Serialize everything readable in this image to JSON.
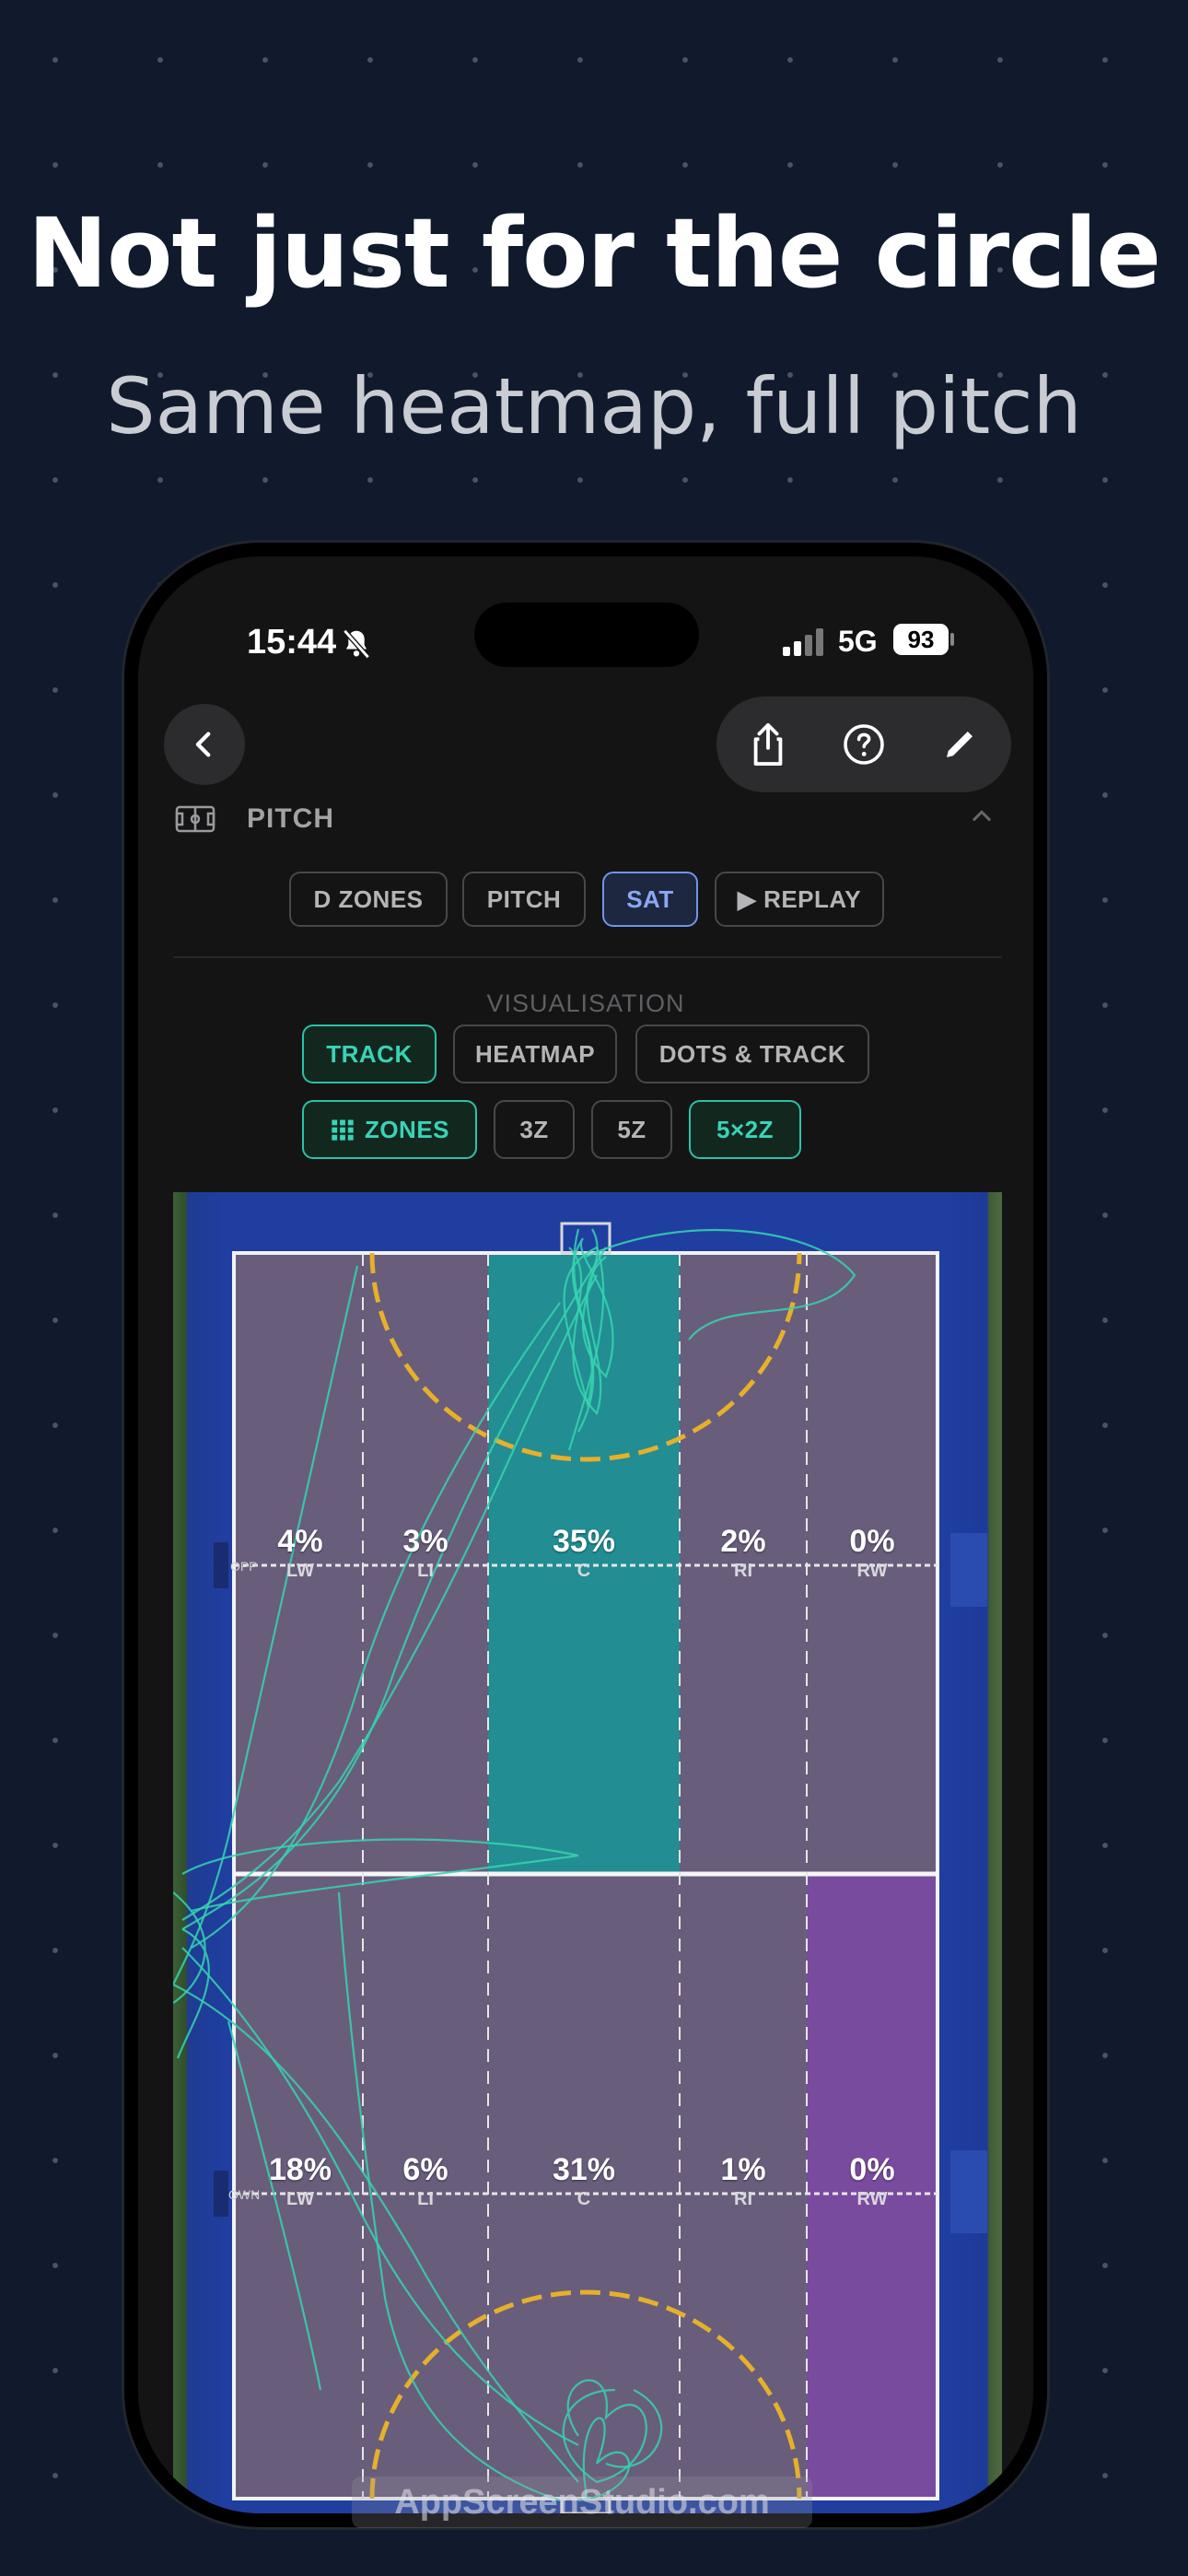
{
  "promo": {
    "headline": "Not just for the circle",
    "subheadline": "Same heatmap, full pitch"
  },
  "status_bar": {
    "time": "15:44",
    "network": "5G",
    "battery": "93"
  },
  "section": {
    "title": "PITCH"
  },
  "view_modes": [
    {
      "label": "D ZONES",
      "active": false
    },
    {
      "label": "PITCH",
      "active": false
    },
    {
      "label": "SAT",
      "active": true
    },
    {
      "label": "▶ REPLAY",
      "active": false
    }
  ],
  "visualisation": {
    "label": "VISUALISATION",
    "modes": [
      {
        "label": "TRACK",
        "active": true
      },
      {
        "label": "HEATMAP",
        "active": false
      },
      {
        "label": "DOTS & TRACK",
        "active": false
      }
    ],
    "zones_toggle": "ZONES",
    "zone_options": [
      {
        "label": "3Z",
        "active": false
      },
      {
        "label": "5Z",
        "active": false
      },
      {
        "label": "5×2Z",
        "active": true
      }
    ]
  },
  "pitch": {
    "attack_half_label": "OPP",
    "defence_half_label": "OWN",
    "attack_zones": [
      {
        "pct": "4%",
        "zone": "LW"
      },
      {
        "pct": "3%",
        "zone": "LI"
      },
      {
        "pct": "35%",
        "zone": "C"
      },
      {
        "pct": "2%",
        "zone": "RI"
      },
      {
        "pct": "0%",
        "zone": "RW"
      }
    ],
    "defence_zones": [
      {
        "pct": "18%",
        "zone": "LW"
      },
      {
        "pct": "6%",
        "zone": "LI"
      },
      {
        "pct": "31%",
        "zone": "C"
      },
      {
        "pct": "1%",
        "zone": "RI"
      },
      {
        "pct": "0%",
        "zone": "RW"
      }
    ],
    "zone_colors": {
      "neutral": "#6e5f7a",
      "hot": "#1f8f93",
      "cold": "#7a4aa0",
      "track": "#36d3b0"
    }
  },
  "watermark": "AppScreenStudio.com"
}
